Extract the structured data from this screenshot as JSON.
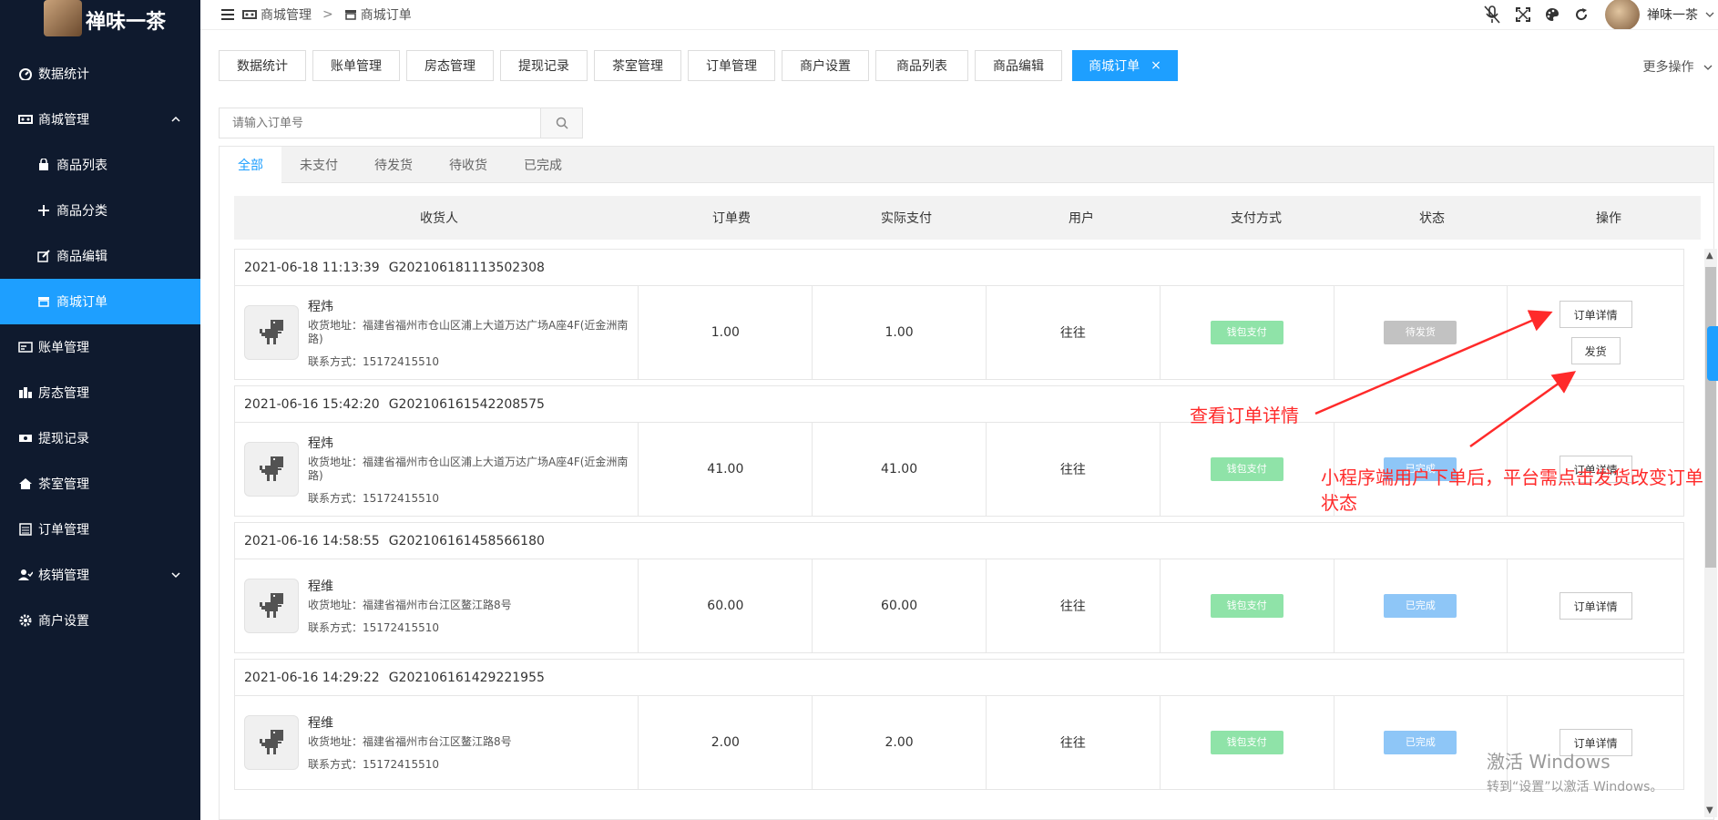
{
  "app": {
    "title": "禅味一茶"
  },
  "sidebar": {
    "items": [
      {
        "label": "数据统计",
        "icon": "dashboard-icon"
      },
      {
        "label": "商城管理",
        "icon": "shop-icon"
      },
      {
        "label": "商品列表",
        "icon": "bag-icon"
      },
      {
        "label": "商品分类",
        "icon": "move-icon"
      },
      {
        "label": "商品编辑",
        "icon": "edit-icon"
      },
      {
        "label": "商城订单",
        "icon": "store-icon"
      },
      {
        "label": "账单管理",
        "icon": "card-icon"
      },
      {
        "label": "房态管理",
        "icon": "building-icon"
      },
      {
        "label": "提现记录",
        "icon": "money-icon"
      },
      {
        "label": "茶室管理",
        "icon": "home-icon"
      },
      {
        "label": "订单管理",
        "icon": "list-icon"
      },
      {
        "label": "核销管理",
        "icon": "user-icon"
      },
      {
        "label": "商户设置",
        "icon": "gear-icon"
      }
    ]
  },
  "header": {
    "breadcrumb": [
      "商城管理",
      "商城订单"
    ],
    "separator": ">",
    "user_name": "禅味一茶"
  },
  "tabs": {
    "items": [
      "数据统计",
      "账单管理",
      "房态管理",
      "提现记录",
      "茶室管理",
      "订单管理",
      "商户设置",
      "商品列表",
      "商品编辑",
      "商城订单"
    ],
    "active": "商城订单",
    "more": "更多操作"
  },
  "search": {
    "placeholder": "请输入订单号"
  },
  "status_tabs": [
    "全部",
    "未支付",
    "待发货",
    "待收货",
    "已完成"
  ],
  "table": {
    "columns": [
      "收货人",
      "订单费",
      "实际支付",
      "用户",
      "支付方式",
      "状态",
      "操作"
    ]
  },
  "orders": [
    {
      "time": "2021-06-18 11:13:39",
      "id": "G202106181113502308",
      "name": "程炜",
      "address": "收货地址：福建省福州市仓山区浦上大道万达广场A座4F(近金洲南路)",
      "phone": "联系方式：15172415510",
      "fee": "1.00",
      "paid": "1.00",
      "user": "往往",
      "pay_method": "钱包支付",
      "status": "待发货",
      "actions": [
        "订单详情",
        "发货"
      ]
    },
    {
      "time": "2021-06-16 15:42:20",
      "id": "G202106161542208575",
      "name": "程炜",
      "address": "收货地址：福建省福州市仓山区浦上大道万达广场A座4F(近金洲南路)",
      "phone": "联系方式：15172415510",
      "fee": "41.00",
      "paid": "41.00",
      "user": "往往",
      "pay_method": "钱包支付",
      "status": "已完成",
      "actions": [
        "订单详情"
      ]
    },
    {
      "time": "2021-06-16 14:58:55",
      "id": "G202106161458566180",
      "name": "程维",
      "address": "收货地址：福建省福州市台江区鳌江路8号",
      "phone": "联系方式：15172415510",
      "fee": "60.00",
      "paid": "60.00",
      "user": "往往",
      "pay_method": "钱包支付",
      "status": "已完成",
      "actions": [
        "订单详情"
      ]
    },
    {
      "time": "2021-06-16 14:29:22",
      "id": "G202106161429221955",
      "name": "程维",
      "address": "收货地址：福建省福州市台江区鳌江路8号",
      "phone": "联系方式：15172415510",
      "fee": "2.00",
      "paid": "2.00",
      "user": "往往",
      "pay_method": "钱包支付",
      "status": "已完成",
      "actions": [
        "订单详情"
      ]
    }
  ],
  "annotations": {
    "detail": "查看订单详情",
    "ship": "小程序端用户下单后，平台需点击发货改变订单状态",
    "color": "#ff2a2a"
  },
  "watermark": {
    "line1": "激活 Windows",
    "line2": "转到“设置”以激活 Windows。"
  },
  "colors": {
    "accent": "#1e9fff",
    "sidebar": "#0f1a2e",
    "pay": "#8fe3a8",
    "wait": "#c2c2c2",
    "done": "#8ec6f7"
  }
}
